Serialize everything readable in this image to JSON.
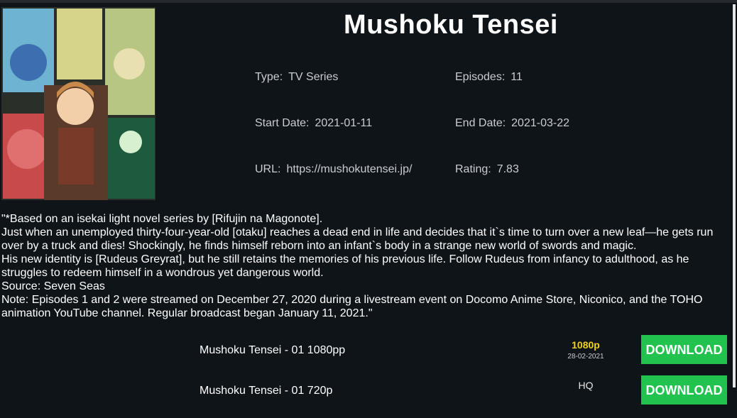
{
  "anime": {
    "title": "Mushoku Tensei",
    "type_label": "Type:",
    "type_value": "TV Series",
    "episodes_label": "Episodes:",
    "episodes_value": "11",
    "start_label": "Start Date:",
    "start_value": "2021-01-11",
    "end_label": "End Date:",
    "end_value": "2021-03-22",
    "url_label": "URL:",
    "url_value": "https://mushokutensei.jp/",
    "rating_label": "Rating:",
    "rating_value": "7.83"
  },
  "synopsis": [
    "\"*Based on an isekai light novel series by  [Rifujin na Magonote].",
    "Just when an unemployed thirty-four-year-old  [otaku] reaches a dead end in life and decides that it`s time to turn over a new leaf—he gets run over by a truck and dies! Shockingly, he finds himself reborn into an infant`s body in a strange new world of swords and magic.",
    "His new identity is  [Rudeus Greyrat], but he still retains the memories of his previous life. Follow Rudeus from infancy to adulthood, as he struggles to redeem himself in a wondrous yet dangerous world.",
    "Source: Seven Seas",
    "Note: Episodes 1 and 2 were streamed on December 27, 2020 during a livestream event on Docomo Anime Store, Niconico, and the TOHO animation YouTube channel. Regular broadcast began January 11, 2021.\""
  ],
  "episodes": [
    {
      "name": "Mushoku Tensei - 01 1080pp",
      "quality": "1080p",
      "date": "28-02-2021",
      "button": "DOWNLOAD"
    },
    {
      "name": "Mushoku Tensei - 01 720p",
      "quality": "HQ",
      "date": "",
      "button": "DOWNLOAD"
    }
  ],
  "colors": {
    "background": "#0f1419",
    "download_button": "#22c24f",
    "quality_1080p": "#f1d21d"
  }
}
